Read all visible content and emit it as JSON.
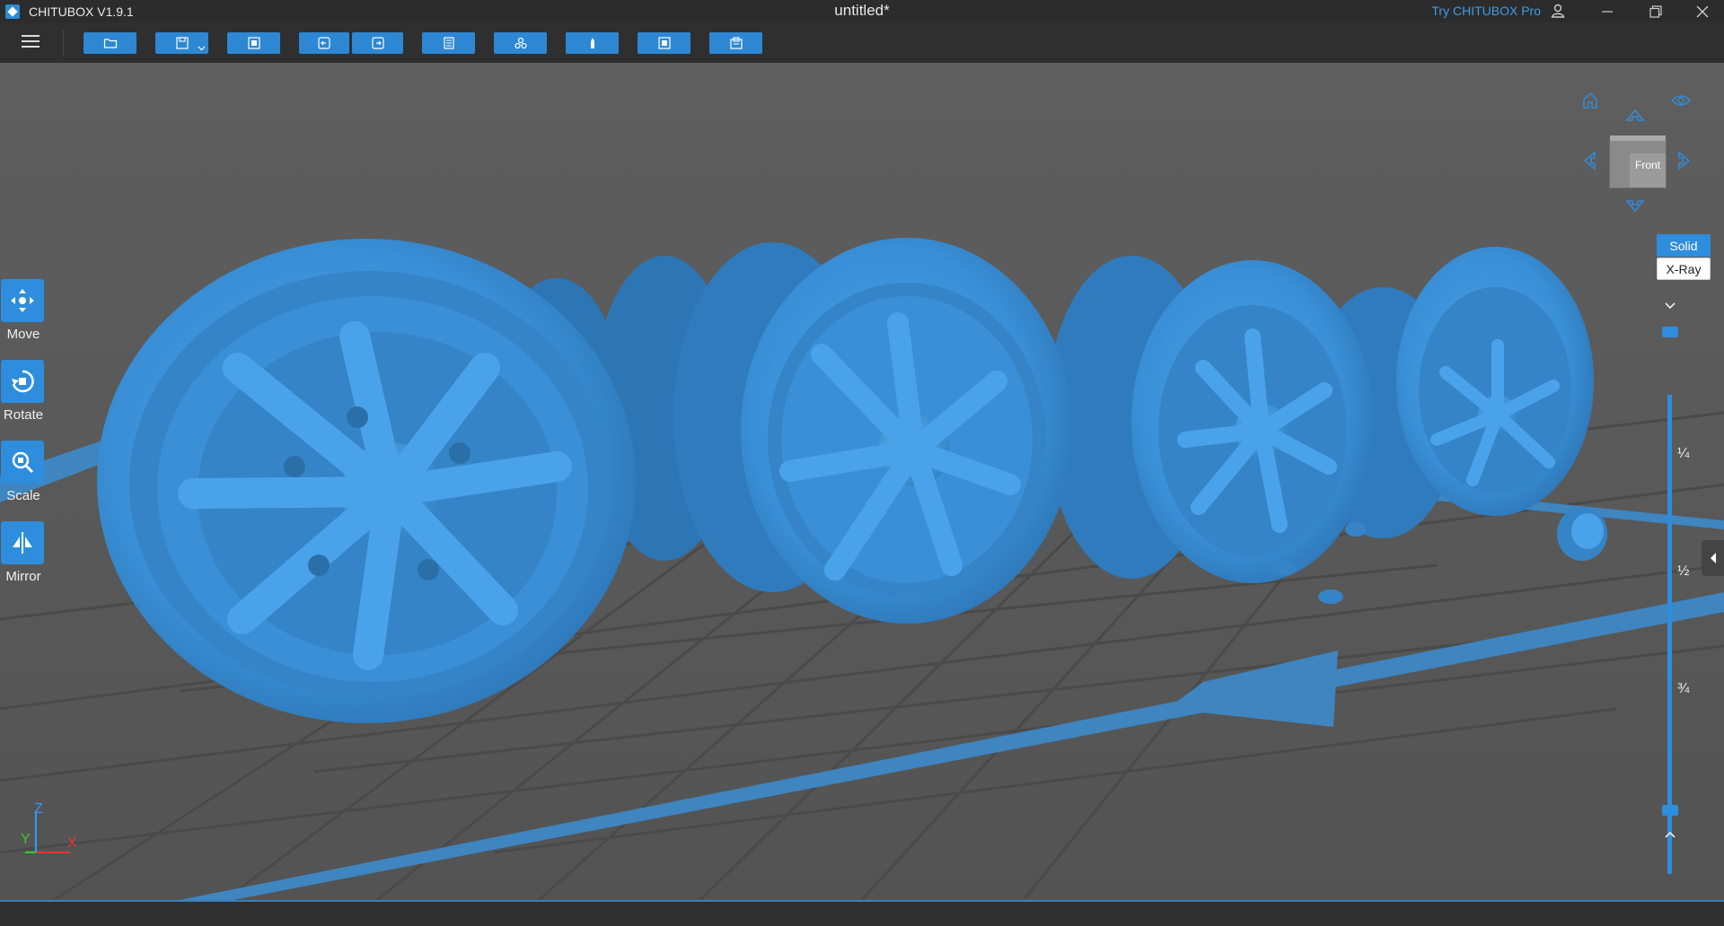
{
  "app": {
    "name": "CHITUBOX V1.9.1",
    "document_title": "untitled*",
    "try_pro": "Try CHITUBOX Pro"
  },
  "window_controls": [
    "minimize-icon",
    "restore-icon",
    "close-icon"
  ],
  "toolbar": {
    "buttons": [
      {
        "name": "open-file",
        "icon": "folder-icon"
      },
      {
        "name": "save",
        "icon": "save-icon",
        "has_dropdown": true
      },
      {
        "name": "auto-layout",
        "icon": "layout-icon"
      },
      {
        "name": "undo",
        "icon": "undo-icon"
      },
      {
        "name": "redo",
        "icon": "redo-icon"
      },
      {
        "name": "settings",
        "icon": "settings-icon"
      },
      {
        "name": "supports",
        "icon": "support-icon"
      },
      {
        "name": "hollow",
        "icon": "hollow-icon"
      },
      {
        "name": "slice",
        "icon": "slice-icon"
      },
      {
        "name": "print",
        "icon": "print-icon"
      }
    ]
  },
  "left_tools": [
    {
      "label": "Move",
      "icon": "move-icon"
    },
    {
      "label": "Rotate",
      "icon": "rotate-icon"
    },
    {
      "label": "Scale",
      "icon": "scale-icon"
    },
    {
      "label": "Mirror",
      "icon": "mirror-icon"
    }
  ],
  "view_cube": {
    "face_label": "Front"
  },
  "render_modes": {
    "solid": "Solid",
    "xray": "X-Ray",
    "active": "Solid"
  },
  "layer_slider": {
    "marks": [
      "¼",
      "½",
      "¾"
    ],
    "top_value": 1.0,
    "bottom_value": 0.0
  },
  "axes": {
    "z": "Z",
    "y": "Y",
    "x": "X"
  },
  "colors": {
    "accent": "#2e8ddc",
    "model": "#3a8fd6",
    "viewport_bg": "#5b5b5b",
    "x_axis": "#e33",
    "y_axis": "#3c3",
    "z_axis": "#39f"
  }
}
